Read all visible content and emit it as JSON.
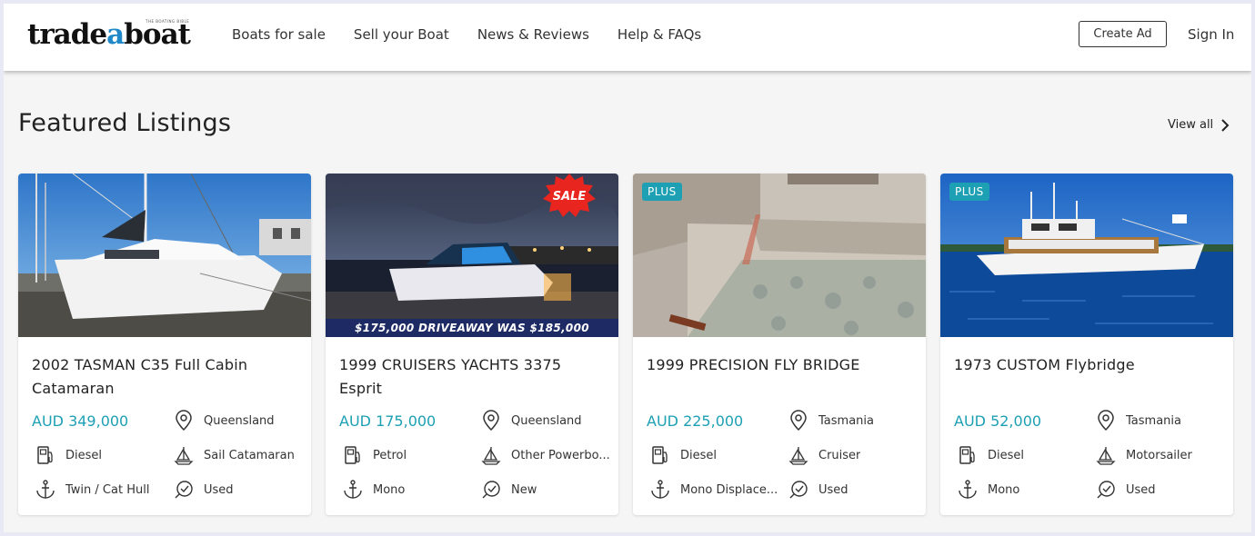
{
  "brand": {
    "logo_main": "trade",
    "logo_accent": "a",
    "logo_end": "boat",
    "tagline": "THE BOATING BIBLE"
  },
  "nav": [
    {
      "label": "Boats for sale"
    },
    {
      "label": "Sell your Boat"
    },
    {
      "label": "News & Reviews"
    },
    {
      "label": "Help & FAQs"
    }
  ],
  "header": {
    "create_ad": "Create Ad",
    "sign_in": "Sign In"
  },
  "section": {
    "title": "Featured Listings",
    "view_all": "View all"
  },
  "colors": {
    "accent": "#1ea0b4",
    "plus_badge": "#1ea0b4",
    "sale_red": "#e8251f",
    "banner_navy": "#1d2a63"
  },
  "listings": [
    {
      "title": "2002 TASMAN C35 Full Cabin Catamaran",
      "price": "AUD 349,000",
      "location": "Queensland",
      "fuel": "Diesel",
      "type": "Sail Catamaran",
      "hull": "Twin / Cat Hull",
      "condition": "Used",
      "badge": "",
      "sale_badge": "",
      "sale_banner": ""
    },
    {
      "title": "1999 CRUISERS YACHTS 3375 Esprit",
      "price": "AUD 175,000",
      "location": "Queensland",
      "fuel": "Petrol",
      "type": "Other Powerbo...",
      "hull": "Mono",
      "condition": "New",
      "badge": "",
      "sale_badge": "SALE",
      "sale_banner": "$175,000 DRIVEAWAY WAS $185,000"
    },
    {
      "title": "1999 PRECISION FLY BRIDGE",
      "price": "AUD 225,000",
      "location": "Tasmania",
      "fuel": "Diesel",
      "type": "Cruiser",
      "hull": "Mono Displace...",
      "condition": "Used",
      "badge": "PLUS",
      "sale_badge": "",
      "sale_banner": ""
    },
    {
      "title": "1973 CUSTOM Flybridge",
      "price": "AUD 52,000",
      "location": "Tasmania",
      "fuel": "Diesel",
      "type": "Motorsailer",
      "hull": "Mono",
      "condition": "Used",
      "badge": "PLUS",
      "sale_badge": "",
      "sale_banner": ""
    }
  ],
  "icons": {
    "location": "map-pin-icon",
    "fuel": "fuel-pump-icon",
    "type": "sailboat-icon",
    "hull": "anchor-icon",
    "condition": "condition-check-icon",
    "view_all": "chevron-right-icon"
  }
}
